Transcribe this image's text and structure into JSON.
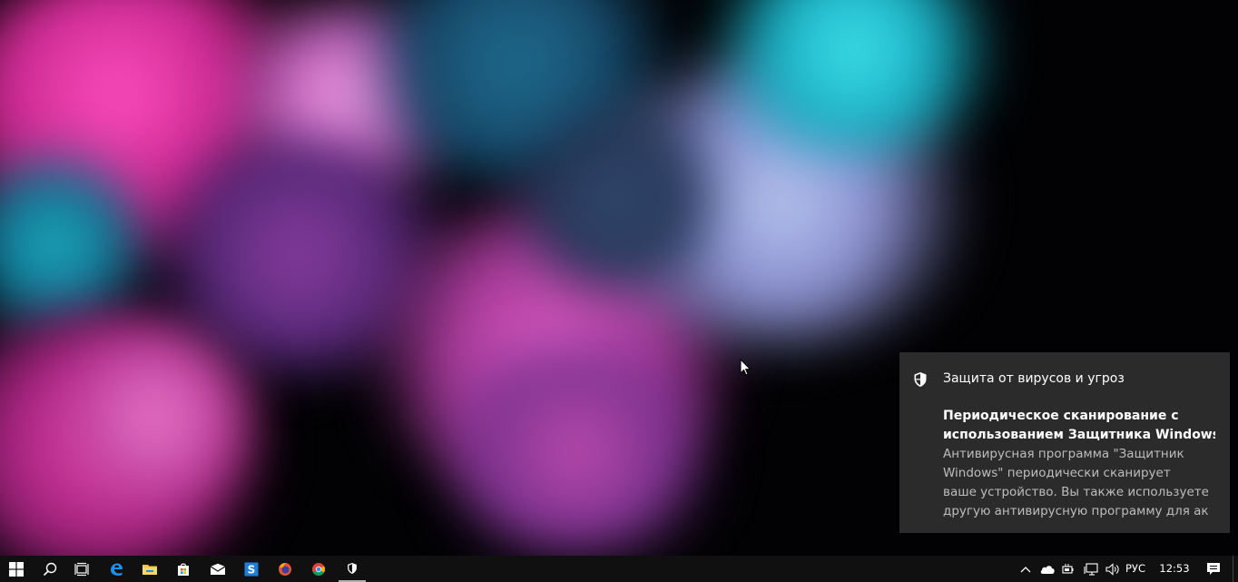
{
  "toast": {
    "app_name": "Защита от вирусов и угроз",
    "title": "Периодическое сканирование с\nиспользованием Защитника Windows в",
    "body": "Антивирусная программа \"Защитник\nWindows\" периодически сканирует\nваше устройство. Вы также используете\nдругую антивирусную программу для ак",
    "icon": "shield-icon",
    "background": "#2b2b2b"
  },
  "taskbar": {
    "background": "#101010",
    "pinned": [
      {
        "name": "start",
        "icon": "windows-logo-icon"
      },
      {
        "name": "search",
        "icon": "search-icon"
      },
      {
        "name": "task-view",
        "icon": "task-view-icon"
      },
      {
        "name": "edge",
        "icon": "edge-icon"
      },
      {
        "name": "file-explorer",
        "icon": "folder-icon"
      },
      {
        "name": "store",
        "icon": "store-bag-icon"
      },
      {
        "name": "mail",
        "icon": "mail-icon"
      },
      {
        "name": "app-s",
        "icon": "s-app-icon"
      },
      {
        "name": "firefox",
        "icon": "firefox-icon"
      },
      {
        "name": "chrome",
        "icon": "chrome-icon"
      },
      {
        "name": "defender",
        "icon": "shield-icon"
      }
    ],
    "tray": {
      "language": "РУС",
      "time": "12:53"
    }
  }
}
